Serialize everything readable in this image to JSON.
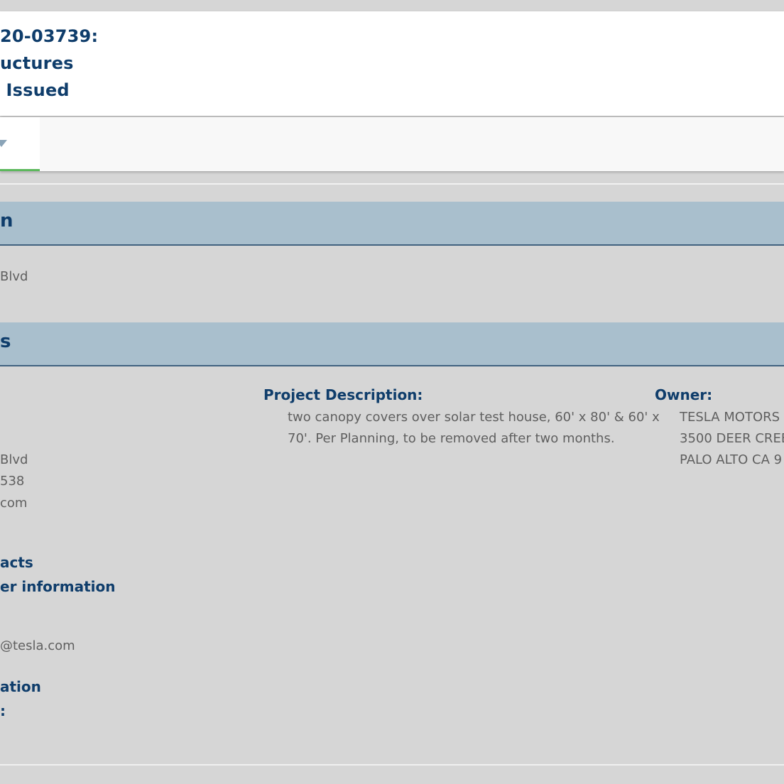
{
  "header": {
    "line1": "20-03739:",
    "line2": "uctures",
    "line3": " Issued"
  },
  "tabs": [
    {
      "icon": "chevron-down-icon"
    }
  ],
  "section_location": {
    "title": "n",
    "address": "Blvd"
  },
  "section_details": {
    "title": "s",
    "left_column": {
      "address": "Blvd",
      "phone": "538",
      "email": "com",
      "contacts_link": "acts",
      "more_info_link": "er information",
      "contact_email": "@tesla.com",
      "location_label": "ation",
      "colon_label": ":"
    },
    "project_description": {
      "label": "Project Description:",
      "line1": "two canopy covers over solar test house, 60' x 80' & 60' x",
      "line2": "70'. Per Planning, to be removed after two months."
    },
    "owner": {
      "label": "Owner:",
      "name": "TESLA MOTORS",
      "street": "3500 DEER CREE",
      "city": "PALO ALTO CA 9"
    }
  },
  "colors": {
    "page_bg": "#d6d6d6",
    "heading_blue": "#0f3d6b",
    "section_bar": "#a9bfcd",
    "active_tab_underline": "#5cb85c"
  }
}
